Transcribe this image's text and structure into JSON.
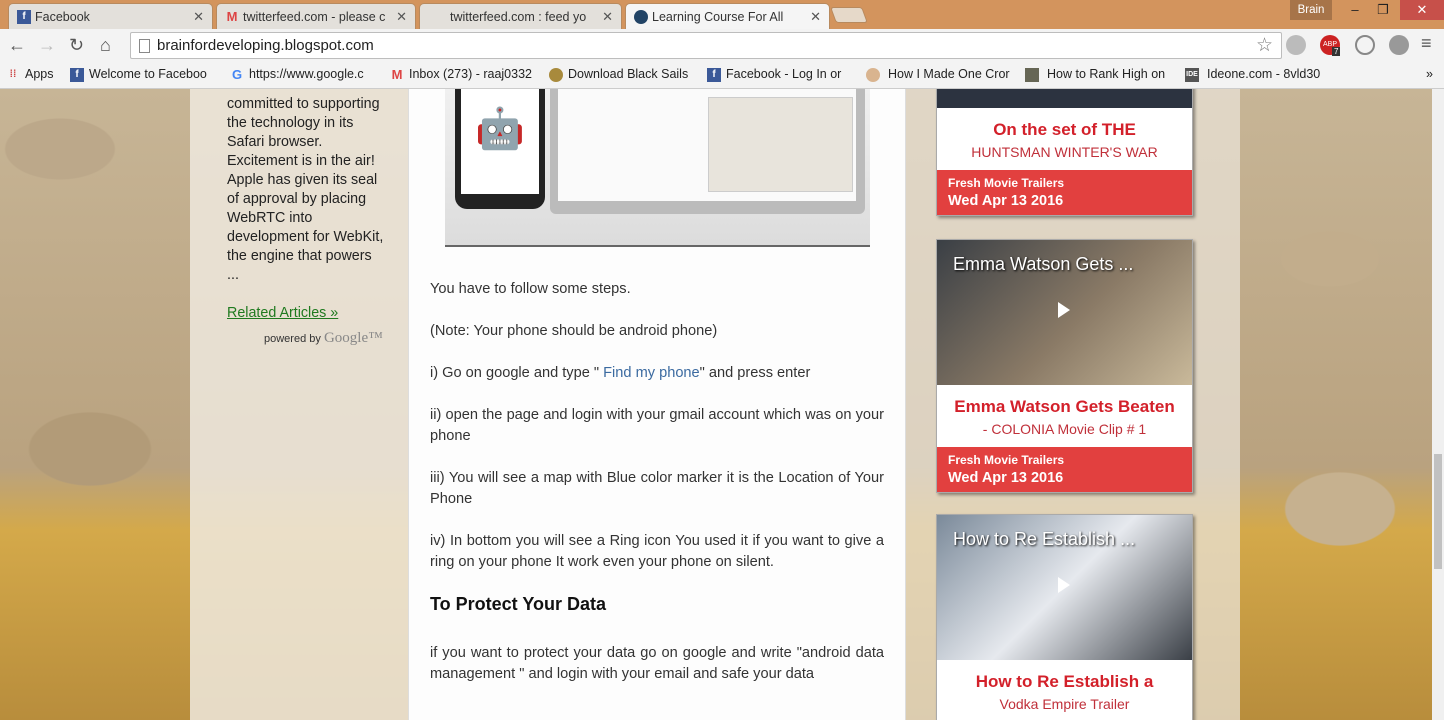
{
  "browser": {
    "tabs": [
      {
        "label": "Facebook"
      },
      {
        "label": "twitterfeed.com - please c"
      },
      {
        "label": "twitterfeed.com : feed yo"
      },
      {
        "label": "Learning Course For All"
      }
    ],
    "profile": "Brain",
    "url": "brainfordeveloping.blogspot.com",
    "extensions": {
      "abp_badge": "7"
    },
    "bookmarks": [
      {
        "label": "Apps"
      },
      {
        "label": "Welcome to Faceboo"
      },
      {
        "label": "https://www.google.c"
      },
      {
        "label": "Inbox (273) - raaj0332"
      },
      {
        "label": "Download Black Sails"
      },
      {
        "label": "Facebook - Log In or"
      },
      {
        "label": "How I Made One Cror"
      },
      {
        "label": "How to Rank High on"
      },
      {
        "label": "Ideone.com - 8vld30"
      }
    ],
    "more": "»"
  },
  "left": {
    "snippet": "committed to supporting the technology in its Safari browser. Excitement is in the air! Apple has given its seal of approval by placing WebRTC into development for WebKit, the engine that powers ...",
    "related": "Related Articles »",
    "powered": "powered by",
    "google": "Google™"
  },
  "article": {
    "p1": "You have to follow some steps.",
    "p2": "(Note: Your phone should be android phone)",
    "p3a": "i) Go on google and type \"",
    "p3link": " Find my phone",
    "p3b": "\" and press enter",
    "p4": "ii) open the page and login with your gmail account which was on your phone",
    "p5": "iii) You will see a map with Blue color marker it is the Location of Your Phone",
    "p6": "iv) In bottom you will see a Ring icon You used it if you want to give a ring on your phone It work even your phone on silent.",
    "h": "To Protect Your Data",
    "p7": "if you want to protect your data go on google and write \"android data management \" and login with your email and safe your data"
  },
  "cards": [
    {
      "title": "On the set of THE",
      "sub": "HUNTSMAN WINTER'S WAR",
      "source": "Fresh Movie Trailers",
      "date": "Wed Apr 13 2016"
    },
    {
      "thumb": "Emma Watson Gets ...",
      "title": "Emma Watson Gets Beaten",
      "sub": "- COLONIA Movie Clip # 1",
      "source": "Fresh Movie Trailers",
      "date": "Wed Apr 13 2016"
    },
    {
      "thumb": "How to Re Establish ...",
      "title": "How to Re Establish a",
      "sub": "Vodka Empire Trailer"
    }
  ]
}
